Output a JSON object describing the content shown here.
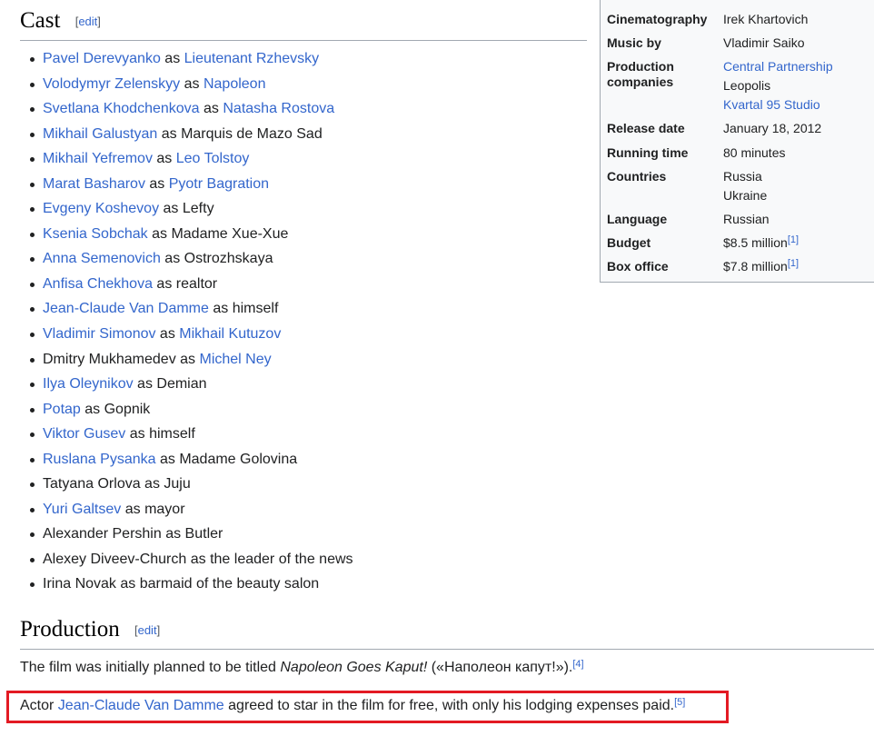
{
  "cast_section": {
    "title": "Cast",
    "edit": {
      "open": "[",
      "label": "edit",
      "close": "]"
    },
    "items": [
      {
        "actor": "Pavel Derevyanko",
        "actor_link": true,
        "as": " as ",
        "role": "Lieutenant Rzhevsky",
        "role_link": true
      },
      {
        "actor": "Volodymyr Zelenskyy",
        "actor_link": true,
        "as": " as ",
        "role": "Napoleon",
        "role_link": true
      },
      {
        "actor": "Svetlana Khodchenkova",
        "actor_link": true,
        "as": " as ",
        "role": "Natasha Rostova",
        "role_link": true
      },
      {
        "actor": "Mikhail Galustyan",
        "actor_link": true,
        "as": " as ",
        "role": "Marquis de Mazo Sad",
        "role_link": false
      },
      {
        "actor": "Mikhail Yefremov",
        "actor_link": true,
        "as": " as ",
        "role": "Leo Tolstoy",
        "role_link": true
      },
      {
        "actor": "Marat Basharov",
        "actor_link": true,
        "as": " as ",
        "role": "Pyotr Bagration",
        "role_link": true
      },
      {
        "actor": "Evgeny Koshevoy",
        "actor_link": true,
        "as": " as ",
        "role": "Lefty",
        "role_link": false
      },
      {
        "actor": "Ksenia Sobchak",
        "actor_link": true,
        "as": " as ",
        "role": "Madame Xue-Xue",
        "role_link": false
      },
      {
        "actor": "Anna Semenovich",
        "actor_link": true,
        "as": " as ",
        "role": "Ostrozhskaya",
        "role_link": false
      },
      {
        "actor": "Anfisa Chekhova",
        "actor_link": true,
        "as": " as ",
        "role": "realtor",
        "role_link": false
      },
      {
        "actor": "Jean-Claude Van Damme",
        "actor_link": true,
        "as": " as ",
        "role": "himself",
        "role_link": false
      },
      {
        "actor": "Vladimir Simonov",
        "actor_link": true,
        "as": " as ",
        "role": "Mikhail Kutuzov",
        "role_link": true
      },
      {
        "actor": "Dmitry Mukhamedev",
        "actor_link": false,
        "as": " as ",
        "role": "Michel Ney",
        "role_link": true
      },
      {
        "actor": "Ilya Oleynikov",
        "actor_link": true,
        "as": " as ",
        "role": "Demian",
        "role_link": false
      },
      {
        "actor": "Potap",
        "actor_link": true,
        "as": " as ",
        "role": "Gopnik",
        "role_link": false
      },
      {
        "actor": "Viktor Gusev",
        "actor_link": true,
        "as": " as ",
        "role": "himself",
        "role_link": false
      },
      {
        "actor": "Ruslana Pysanka",
        "actor_link": true,
        "as": " as ",
        "role": "Madame Golovina",
        "role_link": false
      },
      {
        "actor": "Tatyana Orlova",
        "actor_link": false,
        "as": " as ",
        "role": "Juju",
        "role_link": false
      },
      {
        "actor": "Yuri Galtsev",
        "actor_link": true,
        "as": " as ",
        "role": "mayor",
        "role_link": false
      },
      {
        "actor": "Alexander Pershin",
        "actor_link": false,
        "as": " as ",
        "role": "Butler",
        "role_link": false
      },
      {
        "actor": "Alexey Diveev-Church",
        "actor_link": false,
        "as": " as ",
        "role": "the leader of the news",
        "role_link": false
      },
      {
        "actor": "Irina Novak",
        "actor_link": false,
        "as": " as ",
        "role": "barmaid of the beauty salon",
        "role_link": false
      }
    ]
  },
  "infobox": {
    "cinematography": {
      "label": "Cinematography",
      "value": "Irek Khartovich"
    },
    "music": {
      "label": "Music by",
      "value": "Vladimir Saiko"
    },
    "production": {
      "label_1": "Production",
      "label_2": "companies",
      "v1": "Central Partnership",
      "v2": "Leopolis",
      "v3": "Kvartal 95 Studio"
    },
    "release": {
      "label": "Release date",
      "value": "January 18, 2012"
    },
    "running": {
      "label": "Running time",
      "value": "80 minutes"
    },
    "countries": {
      "label": "Countries",
      "v1": "Russia",
      "v2": "Ukraine"
    },
    "language": {
      "label": "Language",
      "value": "Russian"
    },
    "budget": {
      "label": "Budget",
      "value": "$8.5 million",
      "ref": "[1]"
    },
    "box_office": {
      "label": "Box office",
      "value": "$7.8 million",
      "ref": "[1]"
    }
  },
  "production_section": {
    "title": "Production",
    "edit": {
      "open": "[",
      "label": "edit",
      "close": "]"
    },
    "p1": {
      "prefix": "The film was initially planned to be titled ",
      "title": "Napoleon Goes Kaput!",
      "suffix": " («Наполеон капут!»).",
      "ref": "[4]"
    },
    "p2": {
      "prefix": "Actor ",
      "link": "Jean-Claude Van Damme",
      "suffix": " agreed to star in the film for free, with only his lodging expenses paid.",
      "ref": "[5]"
    }
  },
  "colors": {
    "link": "#3366cc",
    "text": "#202122",
    "highlight": "#e31a23",
    "infobox_bg": "#f8f9fa"
  }
}
